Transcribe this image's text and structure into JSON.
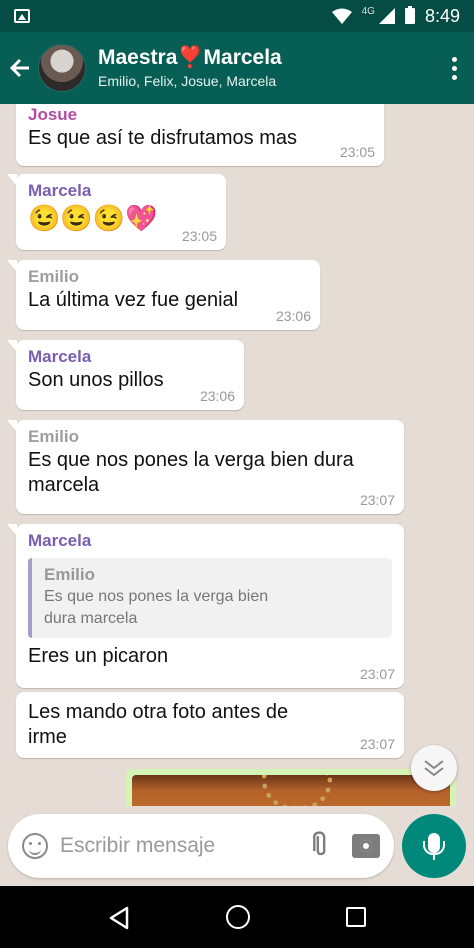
{
  "status_bar": {
    "time": "8:49",
    "network": "4G"
  },
  "header": {
    "title": "Maestra❣️Marcela",
    "subtitle": "Emilio, Felix, Josue, Marcela"
  },
  "messages": [
    {
      "sender": "Josue",
      "sender_color": "#b04ca6",
      "text": "Es que así te disfrutamos mas",
      "time": "23:05"
    },
    {
      "sender": "Marcela",
      "sender_color": "#7a5fb0",
      "text": "😉😉😉💖",
      "time": "23:05"
    },
    {
      "sender": "Emilio",
      "sender_color": "#9e9e9e",
      "text": "La última vez fue genial",
      "time": "23:06"
    },
    {
      "sender": "Marcela",
      "sender_color": "#7a5fb0",
      "text": "Son unos pillos",
      "time": "23:06"
    },
    {
      "sender": "Emilio",
      "sender_color": "#9e9e9e",
      "text": "Es que nos pones la verga bien dura marcela",
      "time": "23:07"
    },
    {
      "sender": "Marcela",
      "sender_color": "#7a5fb0",
      "quote": {
        "sender": "Emilio",
        "text": "Es que nos pones la verga bien dura marcela"
      },
      "text": "Eres un picaron",
      "time": "23:07"
    },
    {
      "text": "Les mando otra foto antes de irme",
      "time": "23:07"
    }
  ],
  "input": {
    "placeholder": "Escribir mensaje"
  },
  "icons": {
    "back": "arrow-left-icon",
    "menu": "more-vert-icon",
    "emoji": "emoji-icon",
    "attach": "paperclip-icon",
    "camera": "camera-icon",
    "mic": "mic-icon",
    "scroll_down": "chevron-down-icon"
  },
  "colors": {
    "header": "#075e54",
    "status_bar": "#054d44",
    "accent": "#00897b",
    "photo_frame": "#d5f3b5"
  }
}
